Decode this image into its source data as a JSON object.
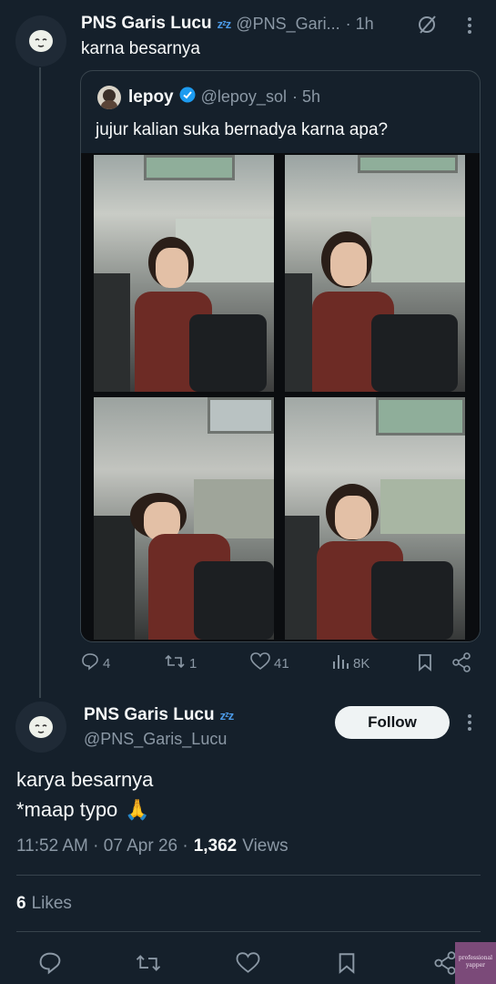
{
  "tweet": {
    "author_name": "PNS Garis Lucu",
    "author_badge": "zᶻz",
    "handle": "@PNS_Gari...",
    "time": "· 1h",
    "text": "karna besarnya"
  },
  "quote": {
    "author_name": "lepoy",
    "handle": "@lepoy_sol",
    "time": "· 5h",
    "text": "jujur kalian suka bernadya karna apa?"
  },
  "stats": {
    "replies": "4",
    "retweets": "1",
    "likes": "41",
    "views": "8K"
  },
  "reply": {
    "author_name": "PNS Garis Lucu",
    "author_badge": "zᶻz",
    "handle": "@PNS_Garis_Lucu",
    "follow_label": "Follow",
    "text_line1": "karya besarnya",
    "text_line2": "*maap typo",
    "emoji": "🙏",
    "time": "11:52 AM · 07 Apr 26 ·",
    "views_count": "1,362",
    "views_label": "Views",
    "likes_count": "6",
    "likes_label": "Likes"
  },
  "watermark": {
    "line1": "professional",
    "line2": "yapper"
  },
  "icons": {
    "reply": "reply-icon",
    "retweet": "retweet-icon",
    "like": "heart-icon",
    "views": "views-icon",
    "bookmark": "bookmark-icon",
    "share": "share-icon",
    "grok": "grok-icon",
    "more": "more-icon",
    "verified": "verified-icon"
  },
  "colors": {
    "background": "#15202b",
    "text": "#f7f9f9",
    "muted": "#8b98a5",
    "verified": "#1d9bf0",
    "border": "#38444d"
  }
}
